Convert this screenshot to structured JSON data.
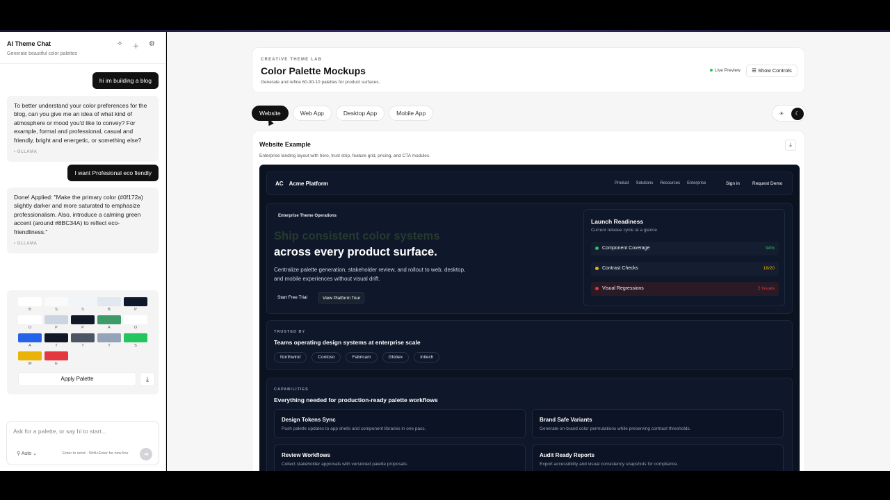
{
  "chat": {
    "title": "AI Theme Chat",
    "subtitle": "Generate beautiful color palettes",
    "icons": [
      "sparkle-icon",
      "plus-icon",
      "gear-icon"
    ],
    "messages": [
      {
        "role": "user",
        "text": "hi im building a blog"
      },
      {
        "role": "assistant",
        "text": "To better understand your color preferences for the blog, can you give me an idea of what kind of atmosphere or mood you'd like to convey? For example, formal and professional, casual and friendly, bright and energetic, or something else?",
        "source": "OLLAMA"
      },
      {
        "role": "user",
        "text": "I want Profesional eco fiendly"
      },
      {
        "role": "assistant",
        "text": "Done! Applied: \"Make the primary color (#0f172a) slightly darker and more saturated to emphasize professionalism. Also, introduce a calming green accent (around #8BC34A) to reflect eco-friendliness.\"",
        "source": "OLLAMA"
      }
    ],
    "palette": {
      "swatches": [
        {
          "label": "B",
          "color": "#ffffff"
        },
        {
          "label": "S",
          "color": "#f8fafc"
        },
        {
          "label": "S",
          "color": "#f1f5f9"
        },
        {
          "label": "B",
          "color": "#e2e8f0"
        },
        {
          "label": "P",
          "color": "#0f172a"
        },
        {
          "label": "O",
          "color": "#ffffff"
        },
        {
          "label": "P",
          "color": "#cbd5e1"
        },
        {
          "label": "P",
          "color": "#111827"
        },
        {
          "label": "A",
          "color": "#3f9a6a"
        },
        {
          "label": "O",
          "color": "#ffffff"
        },
        {
          "label": "A",
          "color": "#2563eb"
        },
        {
          "label": "T",
          "color": "#111827"
        },
        {
          "label": "T",
          "color": "#4b5563"
        },
        {
          "label": "T",
          "color": "#94a3b8"
        },
        {
          "label": "S",
          "color": "#22c55e"
        },
        {
          "label": "W",
          "color": "#eab308"
        },
        {
          "label": "E",
          "color": "#e5373f"
        }
      ],
      "apply_label": "Apply Palette"
    },
    "input": {
      "placeholder": "Ask for a palette, or say hi to start...",
      "mode_label": "Auto",
      "hint": "Enter to send · Shift+Enter for new line"
    }
  },
  "header": {
    "eyebrow": "CREATIVE THEME LAB",
    "title": "Color Palette Mockups",
    "subtitle": "Generate and refine 60-30-10 palettes for product surfaces.",
    "live_label": "Live Preview",
    "controls_label": "Show Controls"
  },
  "tabs": [
    {
      "label": "Website",
      "active": true
    },
    {
      "label": "Web App",
      "active": false
    },
    {
      "label": "Desktop App",
      "active": false
    },
    {
      "label": "Mobile App",
      "active": false
    }
  ],
  "example": {
    "title": "Website Example",
    "subtitle": "Enterprise landing layout with hero, trust strip, feature grid, pricing, and CTA modules."
  },
  "mock": {
    "logo_mark": "AC",
    "logo_name": "Acme Platform",
    "nav_links": [
      "Product",
      "Solutions",
      "Resources",
      "Enterprise"
    ],
    "sign_in": "Sign in",
    "demo": "Request Demo",
    "hero": {
      "eyebrow": "Enterprise Theme Operations",
      "line1": "Ship consistent color systems",
      "line2": "across every product surface.",
      "desc": "Centralize palette generation, stakeholder review, and rollout to web, desktop, and mobile experiences without visual drift.",
      "btn_primary": "Start Free Trial",
      "btn_secondary": "View Platform Tour"
    },
    "launch": {
      "title": "Launch Readiness",
      "subtitle": "Current release cycle at a glance",
      "rows": [
        {
          "name": "Component Coverage",
          "value": "94%",
          "dot": "#22c55e",
          "value_color": "#22c55e",
          "bg": "#141e30"
        },
        {
          "name": "Contrast Checks",
          "value": "18/20",
          "dot": "#eab308",
          "value_color": "#eab308",
          "bg": "#141e30"
        },
        {
          "name": "Visual Regressions",
          "value": "2 Issues",
          "dot": "#e5373f",
          "value_color": "#e5373f",
          "bg": "#2a1a26"
        }
      ]
    },
    "trusted": {
      "eyebrow": "TRUSTED BY",
      "title": "Teams operating design systems at enterprise scale",
      "chips": [
        "Northwind",
        "Contoso",
        "Fabricam",
        "Globex",
        "Initech"
      ]
    },
    "capabilities": {
      "eyebrow": "CAPABILITIES",
      "title": "Everything needed for production-ready palette workflows",
      "items": [
        {
          "title": "Design Tokens Sync",
          "desc": "Push palette updates to app shells and component libraries in one pass."
        },
        {
          "title": "Brand Safe Variants",
          "desc": "Generate on-brand color permutations while preserving contrast thresholds."
        },
        {
          "title": "Review Workflows",
          "desc": "Collect stakeholder approvals with versioned palette proposals."
        },
        {
          "title": "Audit Ready Reports",
          "desc": "Export accessibility and visual consistency snapshots for compliance."
        }
      ]
    }
  }
}
